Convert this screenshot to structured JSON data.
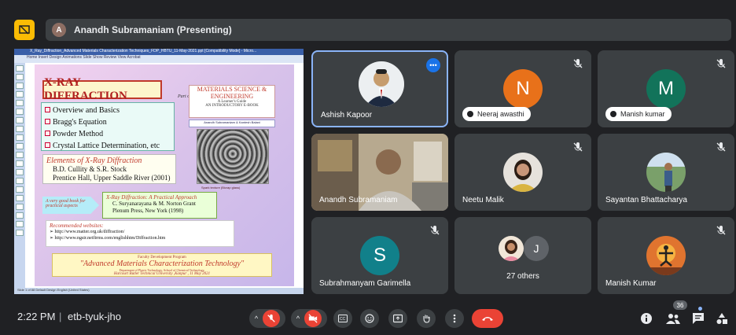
{
  "presenter": {
    "initial": "A",
    "label": "Anandh Subramaniam (Presenting)"
  },
  "slide": {
    "window_title": "X_Ray_Diffraction_Advanced Materials Characterization Techniques_FDP_HBTU_11-May-2021.ppt [Compatibility Mode] - Micro...",
    "ribbon": "Home    Insert    Design    Animations    Slide Show    Review    View    Acrobat",
    "status": "Slide 1 of 88   Default Design   English (United States)",
    "title": "X-RAY DIFFRACTION",
    "bullets": [
      "Overview and Basics",
      "Bragg's Equation",
      "Powder Method",
      "Crystal Lattice Determination, etc"
    ],
    "book1_title": "Elements of X-Ray Diffraction",
    "book1_lines": [
      "B.D. Cullity & S.R. Stock",
      "Prentice Hall, Upper Saddle River (2001)"
    ],
    "good_book": "A very good book for practical aspects",
    "book2_title": "X-Ray Diffraction: A Practical Approach",
    "book2_lines": [
      "C. Suryanarayana & M. Norton Grant",
      "Plenum Press, New York (1998)"
    ],
    "websites_title": "Recommended websites:",
    "websites": [
      "➢ http://www.matter.org.uk/diffraction/",
      "➢ http://www.ngsir.netfirms.com/englishhtm/Diffraction.htm"
    ],
    "fdp_top": "Faculty Development Program",
    "fdp_main": "\"Advanced Materials Characterization Technology\"",
    "fdp_dept": "Department of Plastic Technology, School of Chemical Technology,",
    "fdp_univ": "Harcourt Butler Technical University ,Kanpur , 11 May 2021",
    "part_of": "Part of",
    "ms_title": "MATERIALS SCIENCE & ENGINEERING",
    "ms_guide": "A Learner's Guide",
    "ms_sub": "AN INTRODUCTORY E-BOOK",
    "authors": "Anandh Subramaniam & Kantesh Balani",
    "micro_caption": "Spark texture (Bicrap glass)"
  },
  "participants": [
    {
      "name": "Ashish Kapoor",
      "type": "photo"
    },
    {
      "name": "Neeraj awasthi",
      "initial": "N",
      "color": "#e8711a"
    },
    {
      "name": "Manish kumar",
      "initial": "M",
      "color": "#12735a"
    },
    {
      "name": "Anandh Subramaniam",
      "type": "video"
    },
    {
      "name": "Neetu Malik",
      "type": "photo"
    },
    {
      "name": "Sayantan Bhattacharya",
      "type": "photo"
    },
    {
      "name": "Subrahmanyam Garimella",
      "initial": "S",
      "color": "#11808a"
    },
    {
      "name": "27 others",
      "initial": "J",
      "color": "#5f6368"
    },
    {
      "name": "Manish Kumar",
      "type": "photo"
    }
  ],
  "bottom": {
    "time": "2:22 PM",
    "separator": "|",
    "meeting_code": "etb-tyuk-jho",
    "people_count": "36"
  },
  "icons": [
    "present-icon",
    "mic-off-icon",
    "camera-off-icon",
    "captions-icon",
    "emoji-icon",
    "present-screen-icon",
    "raise-hand-icon",
    "more-vert-icon",
    "end-call-icon",
    "info-icon",
    "people-icon",
    "chat-icon",
    "activities-icon"
  ],
  "colors": {
    "accent": "#8ab4f8",
    "red": "#ea4335",
    "tile": "#3c4043",
    "bg": "#202124"
  }
}
